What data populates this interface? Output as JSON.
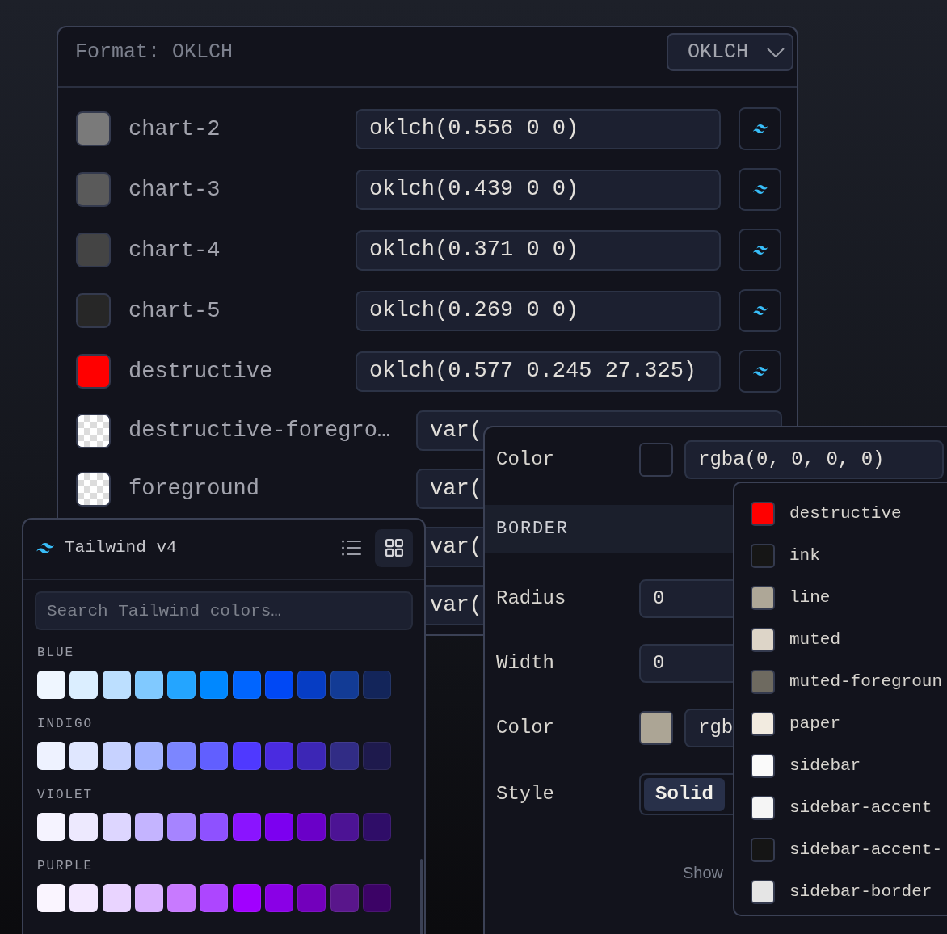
{
  "format_panel": {
    "title": "Format: OKLCH",
    "format_select": {
      "value": "OKLCH"
    },
    "rows": [
      {
        "kind": "literal",
        "name": "chart-2",
        "color": "#7a7a7a",
        "value": "oklch(0.556 0 0)"
      },
      {
        "kind": "literal",
        "name": "chart-3",
        "color": "#5a5a5a",
        "value": "oklch(0.439 0 0)"
      },
      {
        "kind": "literal",
        "name": "chart-4",
        "color": "#444444",
        "value": "oklch(0.371 0 0)"
      },
      {
        "kind": "literal",
        "name": "chart-5",
        "color": "#272727",
        "value": "oklch(0.269 0 0)"
      },
      {
        "kind": "literal",
        "name": "destructive",
        "color": "#ff0000",
        "value": "oklch(0.577 0.245 27.325)"
      },
      {
        "kind": "reference",
        "name": "destructive-foregro…",
        "value": "var("
      },
      {
        "kind": "reference",
        "name": "foreground",
        "value": "var("
      },
      {
        "kind": "reference",
        "value": "var("
      },
      {
        "kind": "reference",
        "value": "var("
      }
    ]
  },
  "palette_panel": {
    "title": "Tailwind v4",
    "views": [
      {
        "kind": "list",
        "selected": false
      },
      {
        "kind": "grid",
        "selected": true
      }
    ],
    "search": {
      "placeholder": "Search Tailwind colors…"
    },
    "groups": [
      {
        "label": "BLUE",
        "swatches": [
          {
            "color": "#eff6ff"
          },
          {
            "color": "#dbeeff"
          },
          {
            "color": "#bcdfff"
          },
          {
            "color": "#80c9ff"
          },
          {
            "color": "#24a5ff"
          },
          {
            "color": "#0088ff"
          },
          {
            "color": "#0065ff"
          },
          {
            "color": "#0048f5"
          },
          {
            "color": "#063dc4"
          },
          {
            "color": "#123b95"
          },
          {
            "color": "#13255a"
          }
        ]
      },
      {
        "label": "INDIGO",
        "swatches": [
          {
            "color": "#eef2ff"
          },
          {
            "color": "#e0e7ff"
          },
          {
            "color": "#c7d2ff"
          },
          {
            "color": "#a3b3ff"
          },
          {
            "color": "#7c86ff"
          },
          {
            "color": "#615fff"
          },
          {
            "color": "#4f39ff"
          },
          {
            "color": "#4a2be0"
          },
          {
            "color": "#3c26b5"
          },
          {
            "color": "#312c85"
          },
          {
            "color": "#1e1a4d"
          }
        ]
      },
      {
        "label": "VIOLET",
        "swatches": [
          {
            "color": "#f5f3ff"
          },
          {
            "color": "#ede9fe"
          },
          {
            "color": "#ddd6ff"
          },
          {
            "color": "#c4b4ff"
          },
          {
            "color": "#a684ff"
          },
          {
            "color": "#8e51ff"
          },
          {
            "color": "#8a14ff"
          },
          {
            "color": "#7c00f0"
          },
          {
            "color": "#6a00c8"
          },
          {
            "color": "#4c1394"
          },
          {
            "color": "#2f0d68"
          }
        ]
      },
      {
        "label": "PURPLE",
        "swatches": [
          {
            "color": "#faf5ff"
          },
          {
            "color": "#f3e8ff"
          },
          {
            "color": "#e9d4ff"
          },
          {
            "color": "#dab2ff"
          },
          {
            "color": "#c87aff"
          },
          {
            "color": "#ad46ff"
          },
          {
            "color": "#a100ff"
          },
          {
            "color": "#8a00e6"
          },
          {
            "color": "#7300bc"
          },
          {
            "color": "#59168b"
          },
          {
            "color": "#3c0366"
          }
        ]
      }
    ]
  },
  "properties_panel": {
    "fill_rows": [
      {
        "kind": "color",
        "label": "Color",
        "value": "rgba(0, 0, 0, 0)"
      }
    ],
    "section": {
      "title": "BORDER"
    },
    "border_rows": [
      {
        "kind": "number",
        "label": "Radius",
        "value": "0"
      },
      {
        "kind": "number",
        "label": "Width",
        "value": "0"
      },
      {
        "kind": "color",
        "label": "Color",
        "color": "#aca595",
        "value": "rgb"
      },
      {
        "kind": "segmented",
        "label": "Style",
        "options": [
          {
            "label": "Solid",
            "selected": true
          }
        ]
      }
    ],
    "link": "Show"
  },
  "color_menu": {
    "items": [
      {
        "label": "destructive",
        "color": "#ff0000"
      },
      {
        "label": "ink",
        "color": "#161616"
      },
      {
        "label": "line",
        "color": "#aea797"
      },
      {
        "label": "muted",
        "color": "#ddd5c8"
      },
      {
        "label": "muted-foregroun",
        "color": "#6e6a60"
      },
      {
        "label": "paper",
        "color": "#f2ebe0"
      },
      {
        "label": "sidebar",
        "color": "#fafafa"
      },
      {
        "label": "sidebar-accent",
        "color": "#f5f5f5"
      },
      {
        "label": "sidebar-accent-",
        "color": "#151515"
      },
      {
        "label": "sidebar-border",
        "color": "#e5e5e5"
      }
    ]
  }
}
